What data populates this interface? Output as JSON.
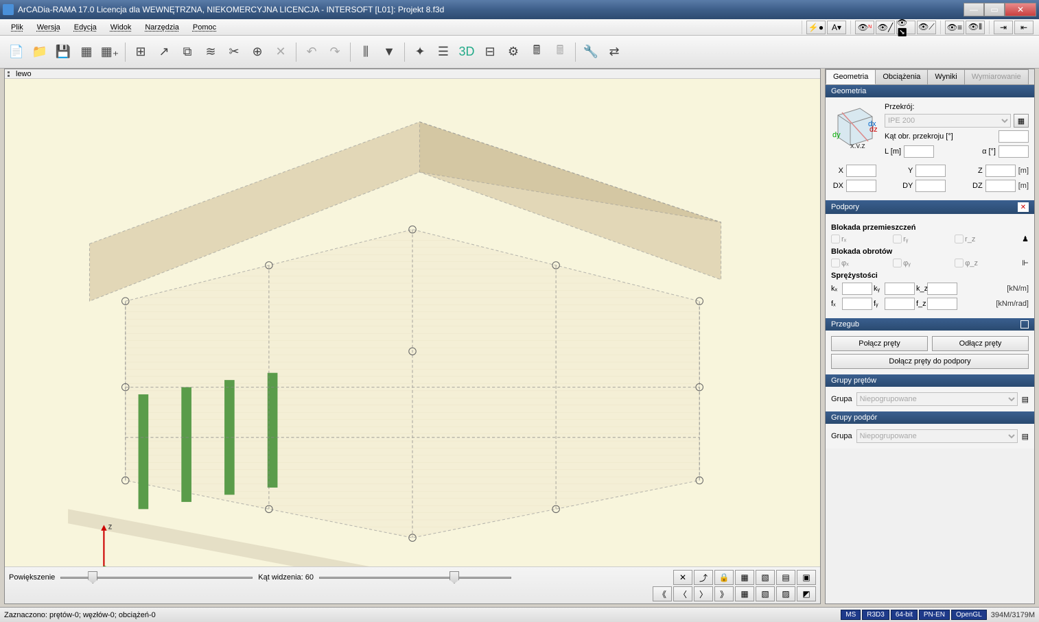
{
  "title": "ArCADia-RAMA 17.0 Licencja dla WEWNĘTRZNA, NIEKOMERCYJNA LICENCJA - INTERSOFT [L01]: Projekt 8.f3d",
  "menu": {
    "items": [
      "Plik",
      "Wersja",
      "Edycja",
      "Widok",
      "Narzędzia",
      "Pomoc"
    ]
  },
  "viewport": {
    "header": "lewo",
    "zoom_label": "Powiększenie",
    "fov_label": "Kąt widzenia: 60"
  },
  "tabs": [
    "Geometria",
    "Obciążenia",
    "Wyniki",
    "Wymiarowanie"
  ],
  "geom": {
    "header": "Geometria",
    "przekroj_label": "Przekrój:",
    "przekroj_value": "IPE 200",
    "kat_obr_label": "Kąt obr. przekroju [°]",
    "kat_obr_value": "",
    "L_label": "L [m]",
    "L_value": "",
    "alpha_label": "α [°]",
    "alpha_value": "",
    "X": {
      "label": "X",
      "value": ""
    },
    "Y": {
      "label": "Y",
      "value": ""
    },
    "Z": {
      "label": "Z",
      "value": "",
      "unit": "[m]"
    },
    "DX": {
      "label": "DX",
      "value": ""
    },
    "DY": {
      "label": "DY",
      "value": ""
    },
    "DZ": {
      "label": "DZ",
      "value": "",
      "unit": "[m]"
    }
  },
  "podpory": {
    "header": "Podpory",
    "blokada_przem": "Blokada przemieszczeń",
    "blokada_obrot": "Blokada obrotów",
    "rx": "rₓ",
    "ry": "rᵧ",
    "rz": "r_z",
    "phix": "φₓ",
    "phiy": "φᵧ",
    "phiz": "φ_z",
    "sprezystosci": "Sprężystości",
    "kx": "kₓ",
    "ky": "kᵧ",
    "kz": "k_z",
    "kunit": "[kN/m]",
    "fx": "fₓ",
    "fy": "fᵧ",
    "fz": "f_z",
    "funit": "[kNm/rad]"
  },
  "przegub": {
    "header": "Przegub",
    "polacz": "Połącz pręty",
    "odlacz": "Odłącz pręty",
    "dolacz": "Dołącz pręty do podpory"
  },
  "grupy_pretow": {
    "header": "Grupy prętów",
    "grupa_label": "Grupa",
    "grupa_value": "Niepogrupowane"
  },
  "grupy_podpor": {
    "header": "Grupy podpór",
    "grupa_label": "Grupa",
    "grupa_value": "Niepogrupowane"
  },
  "status": {
    "selection": "Zaznaczono: prętów-0; węzłów-0; obciążeń-0",
    "badges": [
      "MS",
      "R3D3",
      "64-bit",
      "PN-EN",
      "OpenGL"
    ],
    "memory": "394M/3179M"
  }
}
